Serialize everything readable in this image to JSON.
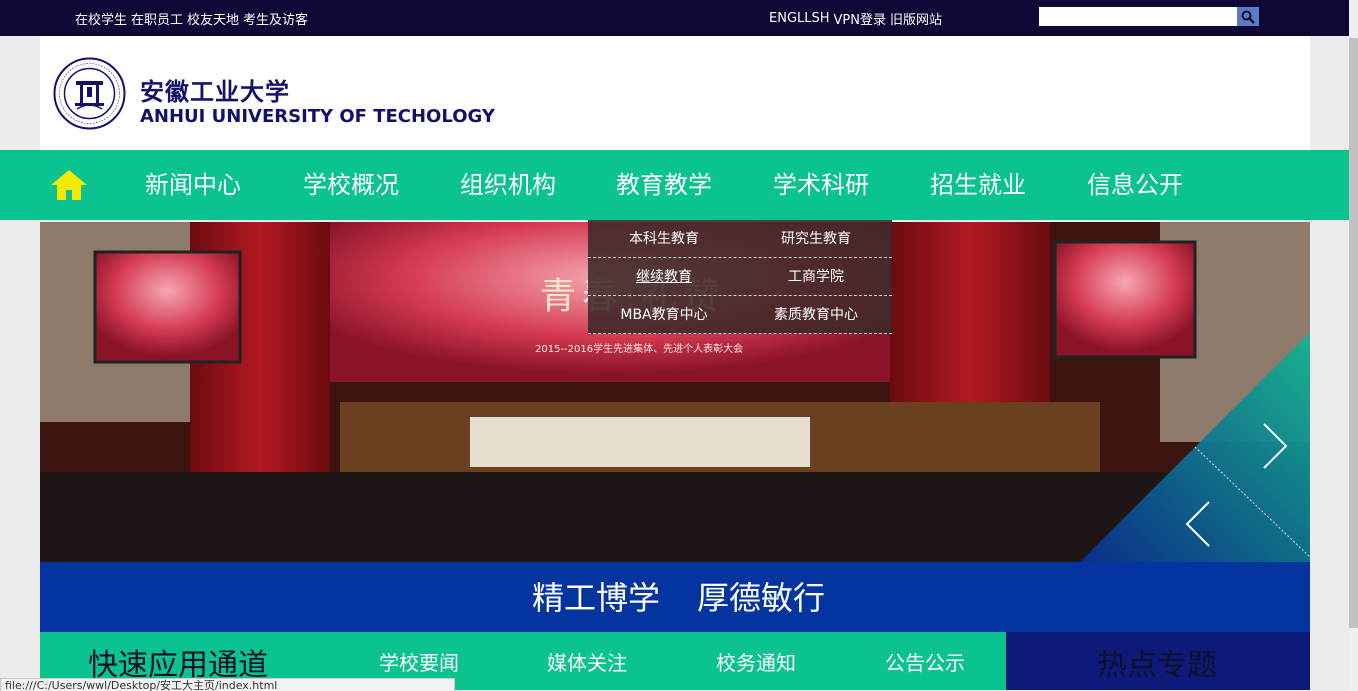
{
  "topbar": {
    "left_links": [
      "在校学生",
      "在职员工",
      "校友天地",
      "考生及访客"
    ],
    "right_links": [
      "ENGLLSH",
      "VPN登录",
      "旧版网站"
    ],
    "search_placeholder": ""
  },
  "header": {
    "name_cn": "安徽工业大学",
    "name_en": "ANHUI UNIVERSITY OF TECHOLOGY"
  },
  "nav": {
    "items": [
      "新闻中心",
      "学校概况",
      "组织机构",
      "教育教学",
      "学术科研",
      "招生就业",
      "信息公开"
    ]
  },
  "dropdown": {
    "items": [
      "本科生教育",
      "研究生教育",
      "继续教育",
      "工商学院",
      "MBA教育中心",
      "素质教育中心"
    ]
  },
  "banner": {
    "slogan": "青春·礼赞",
    "subtitle": "2015--2016学生先进集体、先进个人表彰大会"
  },
  "motto": [
    "精工博学",
    "厚德敏行"
  ],
  "quick": {
    "title": "快速应用通道",
    "tabs": [
      "学校要闻",
      "媒体关注",
      "校务通知",
      "公告公示"
    ]
  },
  "hot": {
    "title": "热点专题"
  },
  "status_url": "file:///C:/Users/wwl/Desktop/安工大主页/index.html",
  "colors": {
    "nav": "#0ac38f",
    "topbar": "#0e0836",
    "motto": "#0334a0",
    "brand_text": "#12126a"
  }
}
